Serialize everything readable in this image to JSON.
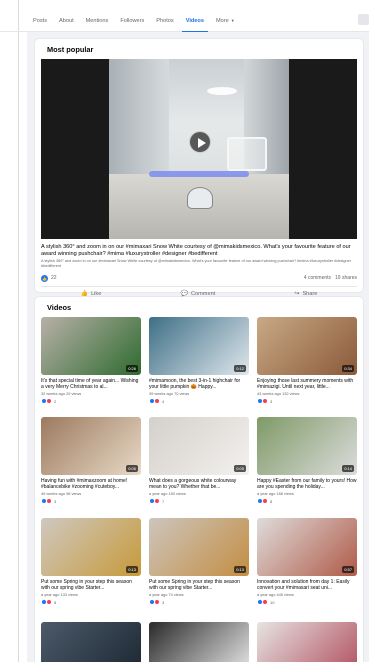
{
  "tabs": [
    {
      "label": "Posts"
    },
    {
      "label": "About"
    },
    {
      "label": "Mentions"
    },
    {
      "label": "Followers"
    },
    {
      "label": "Photos"
    },
    {
      "label": "Videos",
      "active": true
    },
    {
      "label": "More"
    }
  ],
  "popular": {
    "title": "Most popular",
    "caption": "A stylish 360° and zoom in on our #mimaxari Snow White courtesy of @mimakidsmexico. What's your favourite feature of our award winning pushchair? #mima #luxurystroller #designer #bedifferent",
    "caption_sub": "A stylish 360° and zoom in on our #mimaxari Snow White courtesy of @mimakidsmexico. What's your favourite feature of our award winning pushchair? #mima #luxurystroller #designer #bedifferent",
    "reactions": "22",
    "comments": "4 comments",
    "shares": "19 shares",
    "actions": {
      "like": "Like",
      "comment": "Comment",
      "share": "Share"
    }
  },
  "videos": {
    "title": "Videos",
    "items": [
      {
        "duration": "0:26",
        "title": "It's that special time of year again... Wishing a very Merry Christmas to al...",
        "meta": "32 weeks ago  29 views",
        "reactions": "2",
        "thumb": "#b8b0a8",
        "accent": "#2f6b2f"
      },
      {
        "duration": "0:12",
        "title": "#mimamoon, the best 3-in-1 highchair for your little pumpkin 🎃 Happy...",
        "meta": "39 weeks ago  70 views",
        "reactions": "4",
        "thumb": "#3e6f86",
        "accent": "#dfe7ec"
      },
      {
        "duration": "0:34",
        "title": "Enjoying those last summery moments with #mimazigi. Until next year, little...",
        "meta": "43 weeks ago  132 views",
        "reactions": "3",
        "thumb": "#c9a986",
        "accent": "#8a5a3a"
      },
      {
        "duration": "0:06",
        "title": "Having fun with #mimaxzoom at home! #balancebike #zooming #cuteboy...",
        "meta": "49 weeks ago  98 views",
        "reactions": "3",
        "thumb": "#9c7a5f",
        "accent": "#e8d9c6"
      },
      {
        "duration": "0:05",
        "title": "What does a gorgeous white colourway mean to you? Whether that be...",
        "meta": "a year ago  150 views",
        "reactions": "7",
        "thumb": "#d4d0cb",
        "accent": "#f3f1ee"
      },
      {
        "duration": "0:14",
        "title": "Happy #Easter from our family to yours! How are you spending the holiday...",
        "meta": "a year ago  168 views",
        "reactions": "8",
        "thumb": "#7e9a66",
        "accent": "#dcdcdc"
      },
      {
        "duration": "0:13",
        "title": "Put some Spring in your step this season with our spring vibe Starter...",
        "meta": "a year ago  133 views",
        "reactions": "8",
        "thumb": "#cfc8c0",
        "accent": "#c79a3a"
      },
      {
        "duration": "0:13",
        "title": "Put some Spring in your step this season with our spring vibe Starter...",
        "meta": "a year ago  74 views",
        "reactions": "3",
        "thumb": "#cdc5bd",
        "accent": "#c38e42"
      },
      {
        "duration": "0:57",
        "title": "Innovation and solution from day 1: Easily convert your #mimaxari seat uni...",
        "meta": "a year ago  445 views",
        "reactions": "10",
        "thumb": "#dedcda",
        "accent": "#b05a48"
      },
      {
        "duration": "",
        "title": "",
        "meta": "",
        "reactions": "",
        "thumb": "#4c5a6a",
        "accent": "#1a2530"
      },
      {
        "duration": "",
        "title": "",
        "meta": "",
        "reactions": "",
        "thumb": "#2a2a2a",
        "accent": "#f0f0f0"
      },
      {
        "duration": "",
        "title": "",
        "meta": "",
        "reactions": "",
        "thumb": "#e6e4e2",
        "accent": "#b04a5a"
      }
    ]
  }
}
